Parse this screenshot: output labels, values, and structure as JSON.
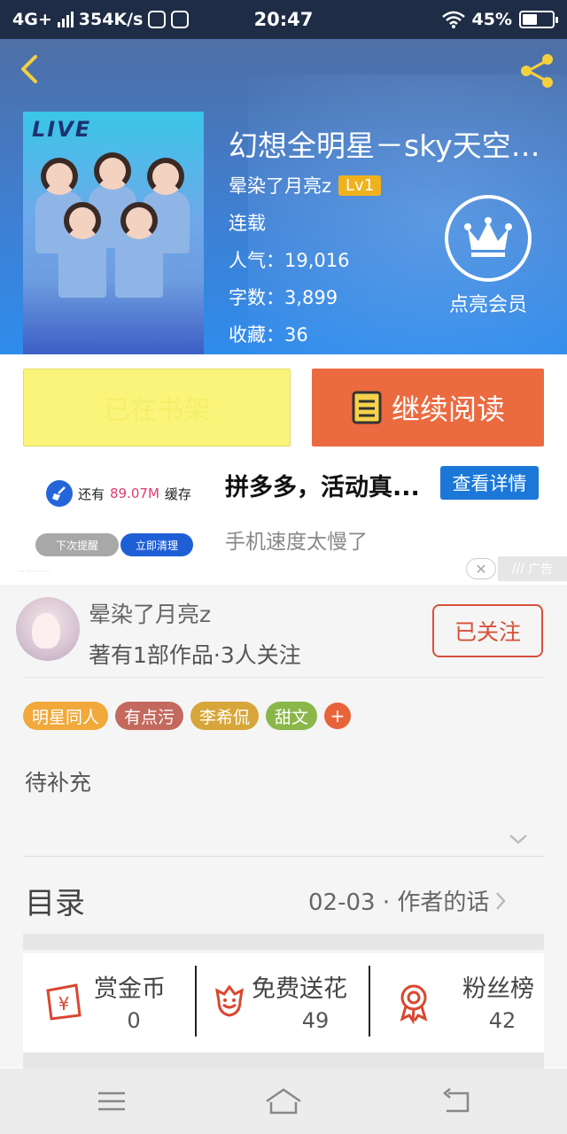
{
  "status_bar": {
    "network": "4G+",
    "speed": "354K/s",
    "time": "20:47",
    "battery": "45%",
    "battery_level": 0.45
  },
  "header": {
    "back_icon": "chevron-left-icon",
    "share_icon": "share-icon"
  },
  "book": {
    "title": "幻想全明星－sky天空少...",
    "author": "晕染了月亮z",
    "level": "Lv1",
    "status": "连载",
    "popularity": "人气：19,016",
    "word_count": "字数：3,899",
    "favorites": "收藏：36"
  },
  "vip": {
    "label": "点亮会员",
    "icon": "crown-icon"
  },
  "actions": {
    "shelf_label": "已在书架",
    "read_label": "继续阅读"
  },
  "ad": {
    "cache_prefix": "还有",
    "cache_amount": "89.07M",
    "cache_suffix": "缓存",
    "remind_label": "下次提醒",
    "clean_label": "立即清理",
    "title": "拼多多，活动真...",
    "detail_label": "查看详情",
    "subtitle": "手机速度太慢了",
    "ad_tag": "广告"
  },
  "author_section": {
    "name": "晕染了月亮z",
    "summary": "著有1部作品·3人关注",
    "follow_label": "已关注",
    "tags": [
      {
        "label": "明星同人",
        "color": "#f0a93a"
      },
      {
        "label": "有点污",
        "color": "#c3695e"
      },
      {
        "label": "李希侃",
        "color": "#d6a63a"
      },
      {
        "label": "甜文",
        "color": "#8bb64a"
      }
    ],
    "tag_add": "+",
    "description": "待补充"
  },
  "toc": {
    "title": "目录",
    "latest": "02-03 · 作者的话"
  },
  "stats": [
    {
      "label": "赏金币",
      "value": "0",
      "icon": "red-envelope-icon"
    },
    {
      "label": "免费送花",
      "value": "49",
      "icon": "flower-icon"
    },
    {
      "label": "粉丝榜",
      "value": "42",
      "icon": "medal-icon"
    }
  ],
  "colors": {
    "accent": "#ec6a3f",
    "shelf": "#fbf47a",
    "header": "#3f7fd2",
    "detail_button": "#1b78d8"
  }
}
